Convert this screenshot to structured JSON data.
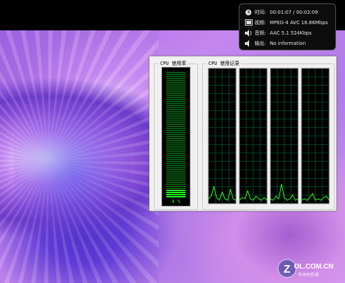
{
  "osd": {
    "rows": [
      {
        "icon": "clock-icon",
        "label": "时间:",
        "value": "00:01:07 / 00:02:09"
      },
      {
        "icon": "video-icon",
        "label": "视频:",
        "value": "MPEG-4 AVC  16.86Mbps"
      },
      {
        "icon": "speaker-icon",
        "label": "音频:",
        "value": "AAC 5.1   524Kbps"
      },
      {
        "icon": "output-icon",
        "label": "输出:",
        "value": "No information"
      }
    ]
  },
  "perf": {
    "usage_title": "CPU 使用率",
    "history_title": "CPU 使用记录",
    "usage_value_text": "4 %",
    "usage_percent": 4,
    "core_count": 4,
    "graph_color": "#2dff2d",
    "grid_color": "#0a7a3a"
  }
}
